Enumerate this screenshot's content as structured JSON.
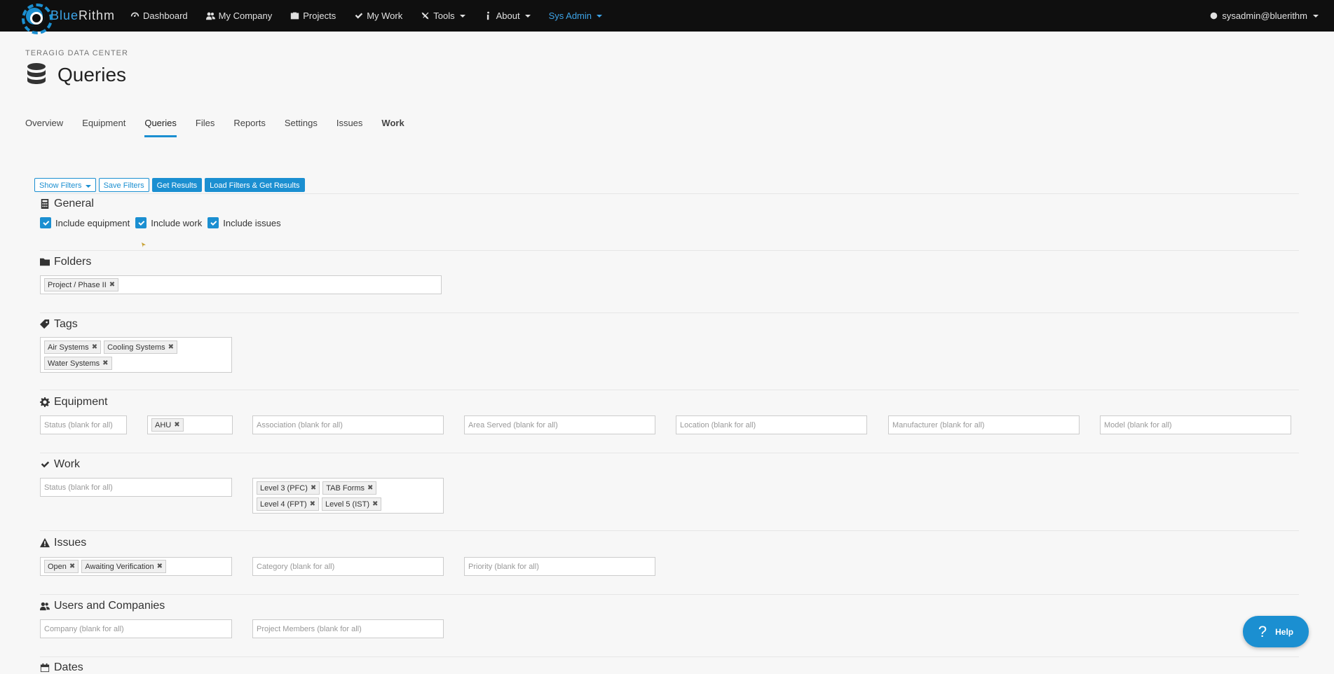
{
  "navbar": {
    "brand_blue": "Blue",
    "brand_rest": "Rithm",
    "items": [
      {
        "label": "Dashboard",
        "icon": "gauge-icon"
      },
      {
        "label": "My Company",
        "icon": "users-icon"
      },
      {
        "label": "Projects",
        "icon": "briefcase-icon"
      },
      {
        "label": "My Work",
        "icon": "check-icon"
      },
      {
        "label": "Tools",
        "icon": "tools-icon"
      },
      {
        "label": "About",
        "icon": "info-icon"
      },
      {
        "label": "Sys Admin"
      }
    ],
    "user": "sysadmin@bluerithm",
    "accent": "#1b8fd1"
  },
  "header": {
    "breadcrumb": "TERAGIG DATA CENTER",
    "title": "Queries"
  },
  "tabs": [
    "Overview",
    "Equipment",
    "Queries",
    "Files",
    "Reports",
    "Settings",
    "Issues",
    "Work"
  ],
  "toolbar": {
    "show_filters": "Show Filters",
    "save_filters": "Save Filters",
    "get_results": "Get Results",
    "load_filters": "Load Filters & Get Results"
  },
  "general": {
    "title": "General",
    "checks": [
      "Include equipment",
      "Include work",
      "Include issues"
    ]
  },
  "folders": {
    "title": "Folders",
    "chips": [
      "Project / Phase II"
    ]
  },
  "tags": {
    "title": "Tags",
    "chips": [
      "Air Systems",
      "Cooling Systems",
      "Water Systems"
    ]
  },
  "equipment": {
    "title": "Equipment",
    "status_placeholder": "Status (blank for all)",
    "type_chip": "AHU",
    "association_placeholder": "Association (blank for all)",
    "area_placeholder": "Area Served (blank for all)",
    "location_placeholder": "Location (blank for all)",
    "manufacturer_placeholder": "Manufacturer (blank for all)",
    "model_placeholder": "Model (blank for all)"
  },
  "work": {
    "title": "Work",
    "status_placeholder": "Status (blank for all)",
    "chips": [
      "Level 3 (PFC)",
      "TAB Forms",
      "Level 4 (FPT)",
      "Level 5 (IST)"
    ]
  },
  "issues": {
    "title": "Issues",
    "status_chips": [
      "Open",
      "Awaiting Verification"
    ],
    "category_placeholder": "Category (blank for all)",
    "priority_placeholder": "Priority (blank for all)"
  },
  "users": {
    "title": "Users and Companies",
    "company_placeholder": "Company (blank for all)",
    "members_placeholder": "Project Members (blank for all)"
  },
  "dates": {
    "title": "Dates"
  },
  "help": {
    "q": "?",
    "label": "Help"
  }
}
